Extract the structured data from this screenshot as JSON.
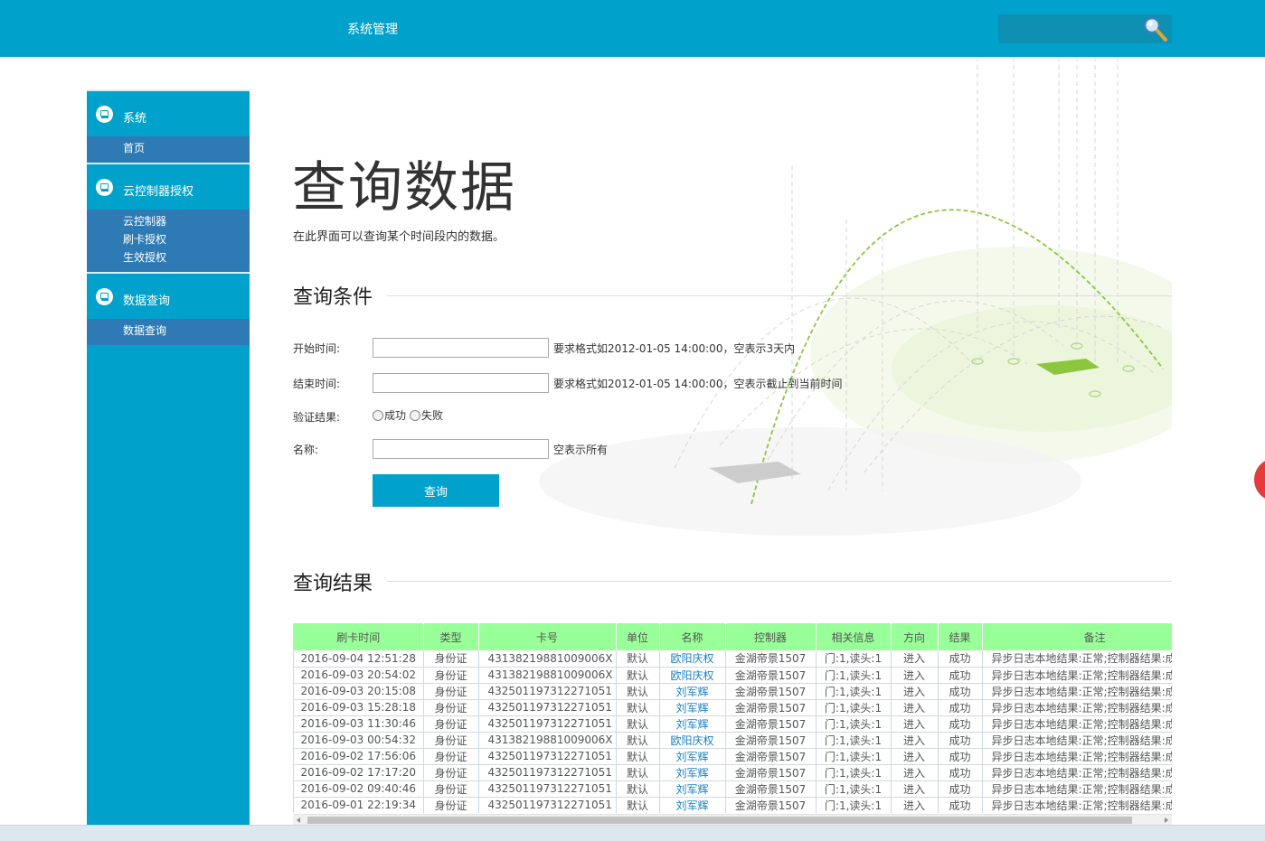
{
  "header": {
    "title": "系统管理",
    "search_placeholder": ""
  },
  "sidebar": {
    "groups": [
      {
        "label": "系统",
        "items": [
          "首页"
        ]
      },
      {
        "label": "云控制器授权",
        "items": [
          "云控制器",
          "刷卡授权",
          "生效授权"
        ]
      },
      {
        "label": "数据查询",
        "items": [
          "数据查询"
        ]
      }
    ]
  },
  "main": {
    "title": "查询数据",
    "description": "在此界面可以查询某个时间段内的数据。",
    "conditions_title": "查询条件",
    "results_title": "查询结果",
    "form": {
      "start_label": "开始时间:",
      "start_value": "",
      "start_hint": "要求格式如2012-01-05 14:00:00，空表示3天内",
      "end_label": "结束时间:",
      "end_value": "",
      "end_hint": "要求格式如2012-01-05 14:00:00，空表示截止到当前时间",
      "result_label": "验证结果:",
      "result_options": [
        "成功",
        "失败"
      ],
      "name_label": "名称:",
      "name_value": "",
      "name_hint": "空表示所有",
      "query_button": "查询"
    }
  },
  "table": {
    "columns": [
      "刷卡时间",
      "类型",
      "卡号",
      "单位",
      "名称",
      "控制器",
      "相关信息",
      "方向",
      "结果",
      "备注"
    ],
    "rows": [
      [
        "2016-09-04 12:51:28",
        "身份证",
        "43138219881009006X",
        "默认",
        "欧阳庆权",
        "金湖帝景1507",
        "门:1,读头:1",
        "进入",
        "成功",
        "异步日志本地结果:正常;控制器结果:成功"
      ],
      [
        "2016-09-03 20:54:02",
        "身份证",
        "43138219881009006X",
        "默认",
        "欧阳庆权",
        "金湖帝景1507",
        "门:1,读头:1",
        "进入",
        "成功",
        "异步日志本地结果:正常;控制器结果:成功"
      ],
      [
        "2016-09-03 20:15:08",
        "身份证",
        "432501197312271051",
        "默认",
        "刘军辉",
        "金湖帝景1507",
        "门:1,读头:1",
        "进入",
        "成功",
        "异步日志本地结果:正常;控制器结果:成功"
      ],
      [
        "2016-09-03 15:28:18",
        "身份证",
        "432501197312271051",
        "默认",
        "刘军辉",
        "金湖帝景1507",
        "门:1,读头:1",
        "进入",
        "成功",
        "异步日志本地结果:正常;控制器结果:成功"
      ],
      [
        "2016-09-03 11:30:46",
        "身份证",
        "432501197312271051",
        "默认",
        "刘军辉",
        "金湖帝景1507",
        "门:1,读头:1",
        "进入",
        "成功",
        "异步日志本地结果:正常;控制器结果:成功"
      ],
      [
        "2016-09-03 00:54:32",
        "身份证",
        "43138219881009006X",
        "默认",
        "欧阳庆权",
        "金湖帝景1507",
        "门:1,读头:1",
        "进入",
        "成功",
        "异步日志本地结果:正常;控制器结果:成功"
      ],
      [
        "2016-09-02 17:56:06",
        "身份证",
        "432501197312271051",
        "默认",
        "刘军辉",
        "金湖帝景1507",
        "门:1,读头:1",
        "进入",
        "成功",
        "异步日志本地结果:正常;控制器结果:成功"
      ],
      [
        "2016-09-02 17:17:20",
        "身份证",
        "432501197312271051",
        "默认",
        "刘军辉",
        "金湖帝景1507",
        "门:1,读头:1",
        "进入",
        "成功",
        "异步日志本地结果:正常;控制器结果:成功"
      ],
      [
        "2016-09-02 09:40:46",
        "身份证",
        "432501197312271051",
        "默认",
        "刘军辉",
        "金湖帝景1507",
        "门:1,读头:1",
        "进入",
        "成功",
        "异步日志本地结果:正常;控制器结果:成功"
      ],
      [
        "2016-09-01 22:19:34",
        "身份证",
        "432501197312271051",
        "默认",
        "刘军辉",
        "金湖帝景1507",
        "门:1,读头:1",
        "进入",
        "成功",
        "异步日志本地结果:正常;控制器结果:成功"
      ]
    ]
  },
  "icons": {
    "search": "magnifier-icon",
    "group": "monitor-icon"
  },
  "colors": {
    "header_bg": "#00a2cb",
    "sidebar_bg": "#00a2cb",
    "submenu_bg": "#2e7ab5",
    "table_header_bg": "#99ff99",
    "link": "#1a7fc0"
  }
}
